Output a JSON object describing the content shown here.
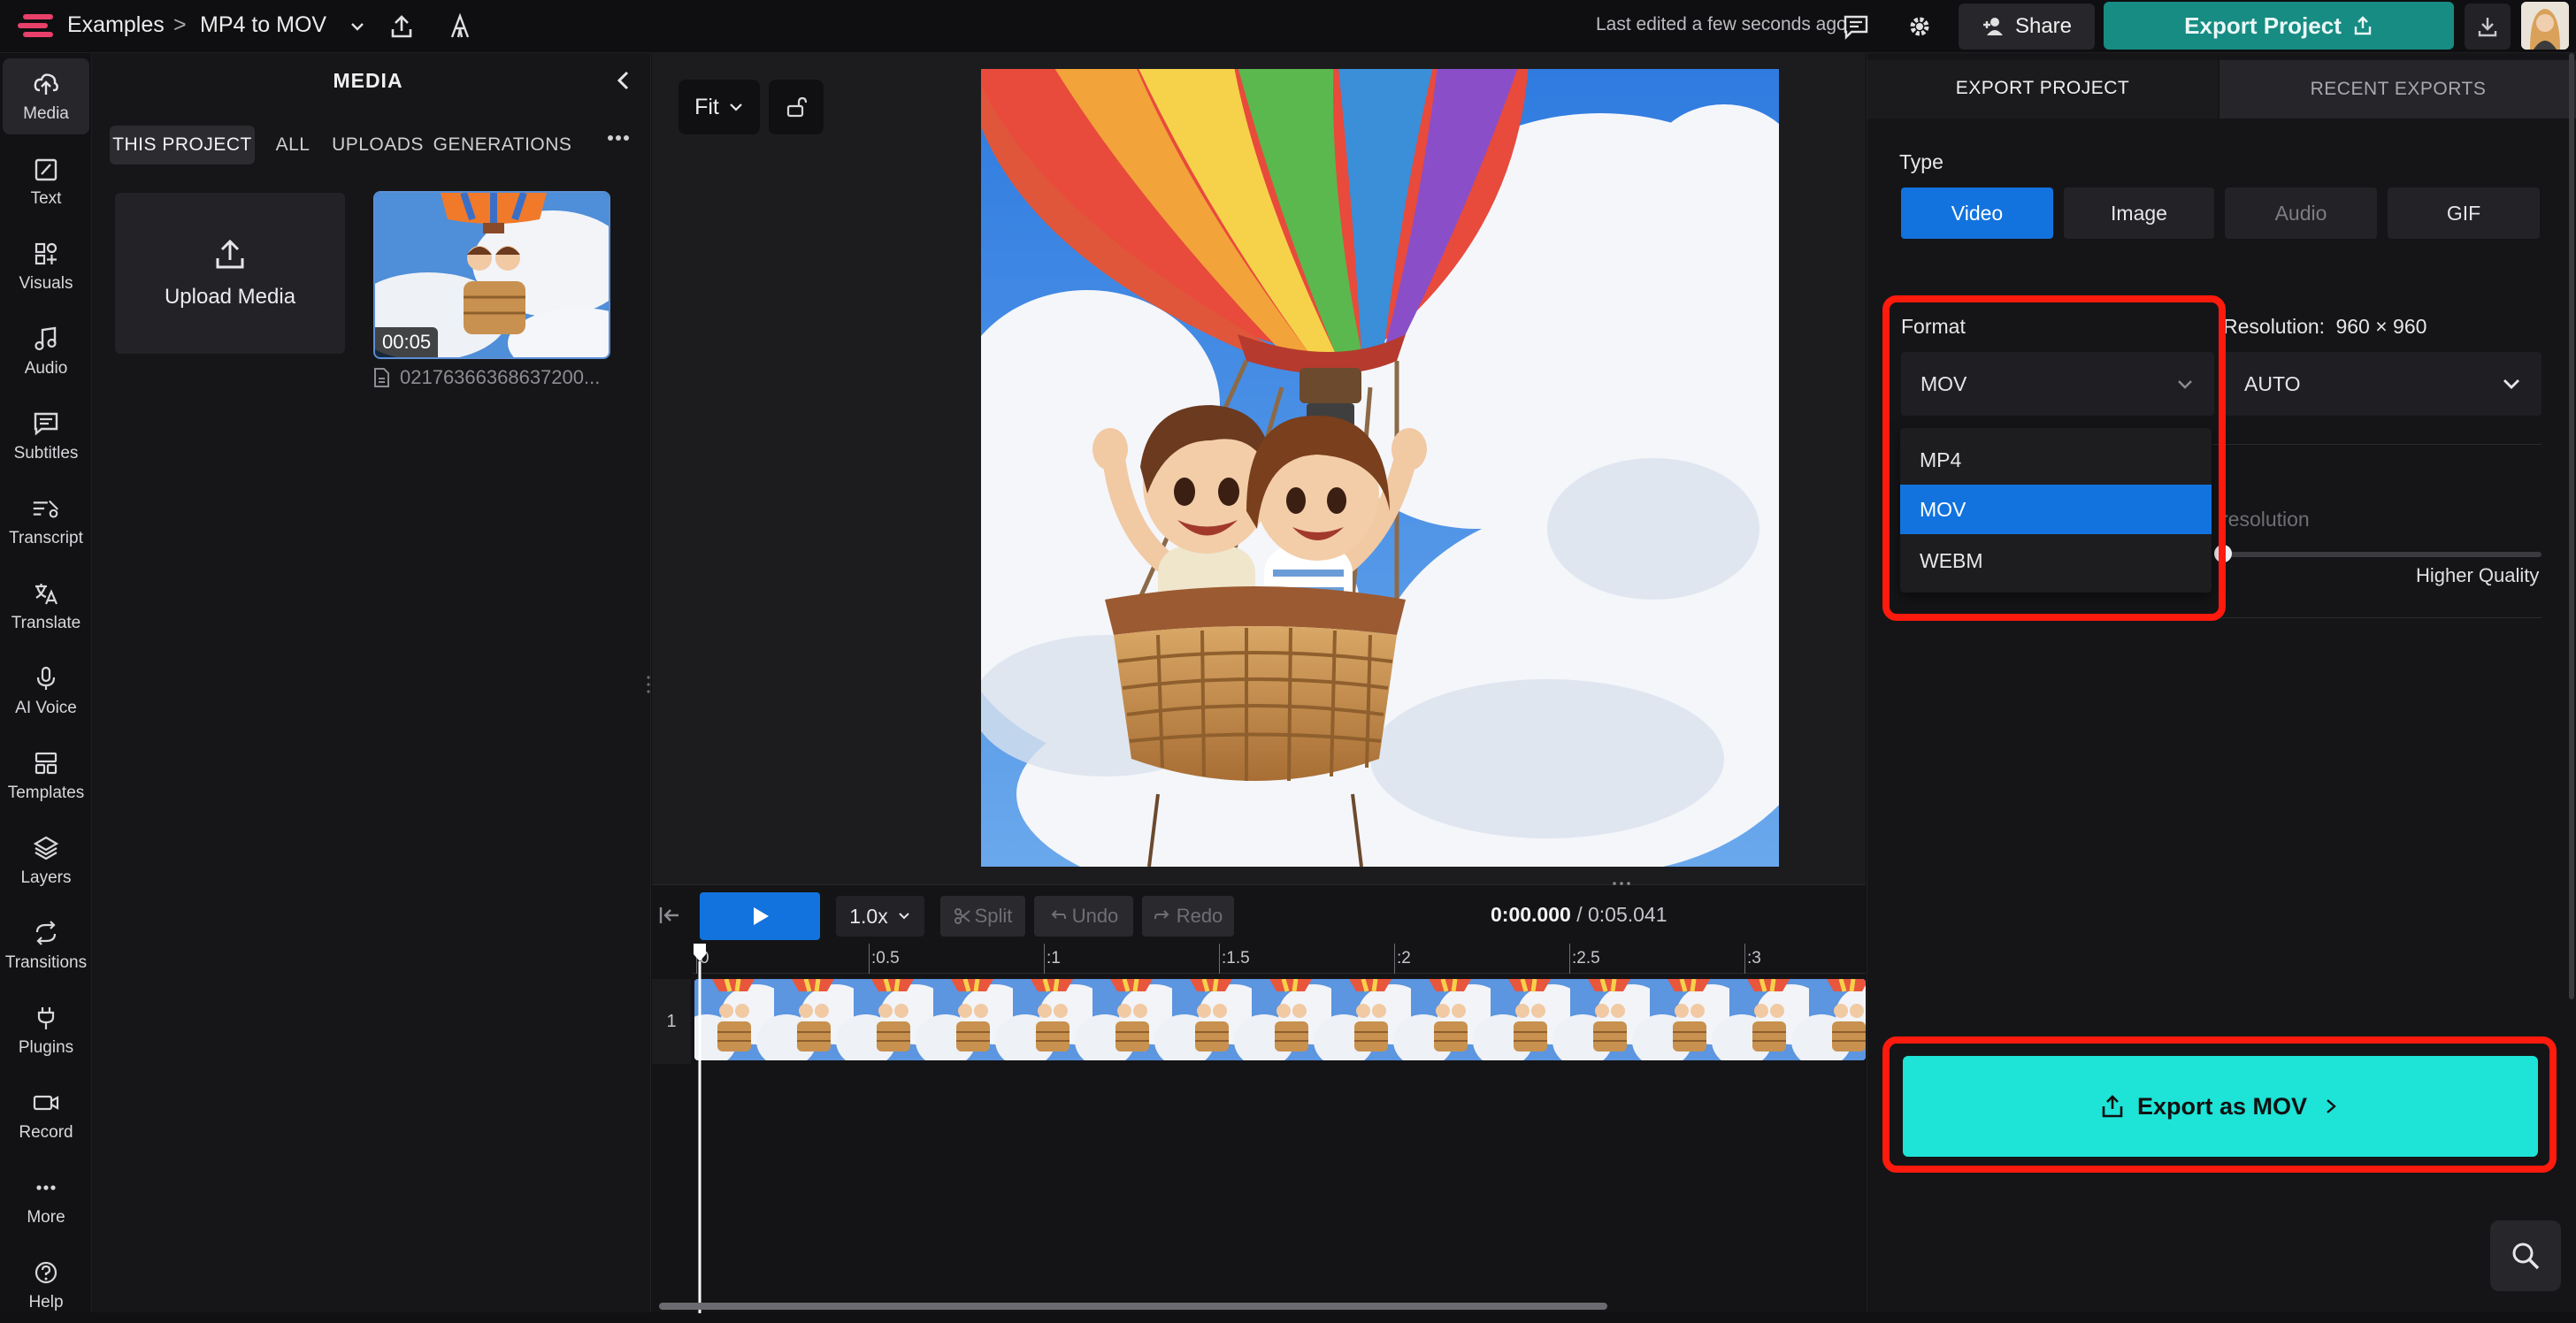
{
  "topbar": {
    "breadcrumb_root": "Examples",
    "breadcrumb_sep": ">",
    "project_name": "MP4 to MOV",
    "last_edited": "Last edited a few seconds ago",
    "share_label": "Share",
    "export_label": "Export Project",
    "accent": "#168c82"
  },
  "rail": {
    "items": [
      {
        "label": "Media",
        "icon": "upload-cloud-icon"
      },
      {
        "label": "Text",
        "icon": "text-edit-icon"
      },
      {
        "label": "Visuals",
        "icon": "shapes-icon"
      },
      {
        "label": "Audio",
        "icon": "music-note-icon"
      },
      {
        "label": "Subtitles",
        "icon": "subtitles-icon"
      },
      {
        "label": "Transcript",
        "icon": "transcript-icon"
      },
      {
        "label": "Translate",
        "icon": "translate-icon"
      },
      {
        "label": "AI Voice",
        "icon": "microphone-icon"
      },
      {
        "label": "Templates",
        "icon": "templates-icon"
      },
      {
        "label": "Layers",
        "icon": "layers-icon"
      },
      {
        "label": "Transitions",
        "icon": "transitions-icon"
      },
      {
        "label": "Plugins",
        "icon": "plug-icon"
      },
      {
        "label": "Record",
        "icon": "camera-icon"
      },
      {
        "label": "More",
        "icon": "more-dots-icon"
      },
      {
        "label": "Help",
        "icon": "help-icon"
      }
    ]
  },
  "media": {
    "title": "MEDIA",
    "tabs": [
      "THIS PROJECT",
      "ALL",
      "UPLOADS",
      "GENERATIONS"
    ],
    "upload_label": "Upload Media",
    "clip_duration": "00:05",
    "clip_filename": "02176366368637200..."
  },
  "stage": {
    "fit_label": "Fit"
  },
  "timeline": {
    "speed": "1.0x",
    "split_label": "Split",
    "undo_label": "Undo",
    "redo_label": "Redo",
    "current_time": "0:00.000",
    "total_time": "/ 0:05.041",
    "ruler": [
      "0",
      ":0.5",
      ":1",
      ":1.5",
      ":2",
      ":2.5",
      ":3"
    ],
    "track_number": "1"
  },
  "export": {
    "tab_export": "EXPORT PROJECT",
    "tab_recent": "RECENT EXPORTS",
    "type_label": "Type",
    "types": [
      "Video",
      "Image",
      "Audio",
      "GIF"
    ],
    "format_label": "Format",
    "format_value": "MOV",
    "format_options": [
      "MP4",
      "MOV",
      "WEBM"
    ],
    "resolution_label": "Resolution:",
    "resolution_value": "960 × 960",
    "resolution_select": "AUTO",
    "resolution_partial": "resolution",
    "quality_label": "Higher Quality",
    "export_button": "Export as MOV",
    "button_color": "#1ee3d7",
    "highlight_color": "#ff1a0e"
  }
}
